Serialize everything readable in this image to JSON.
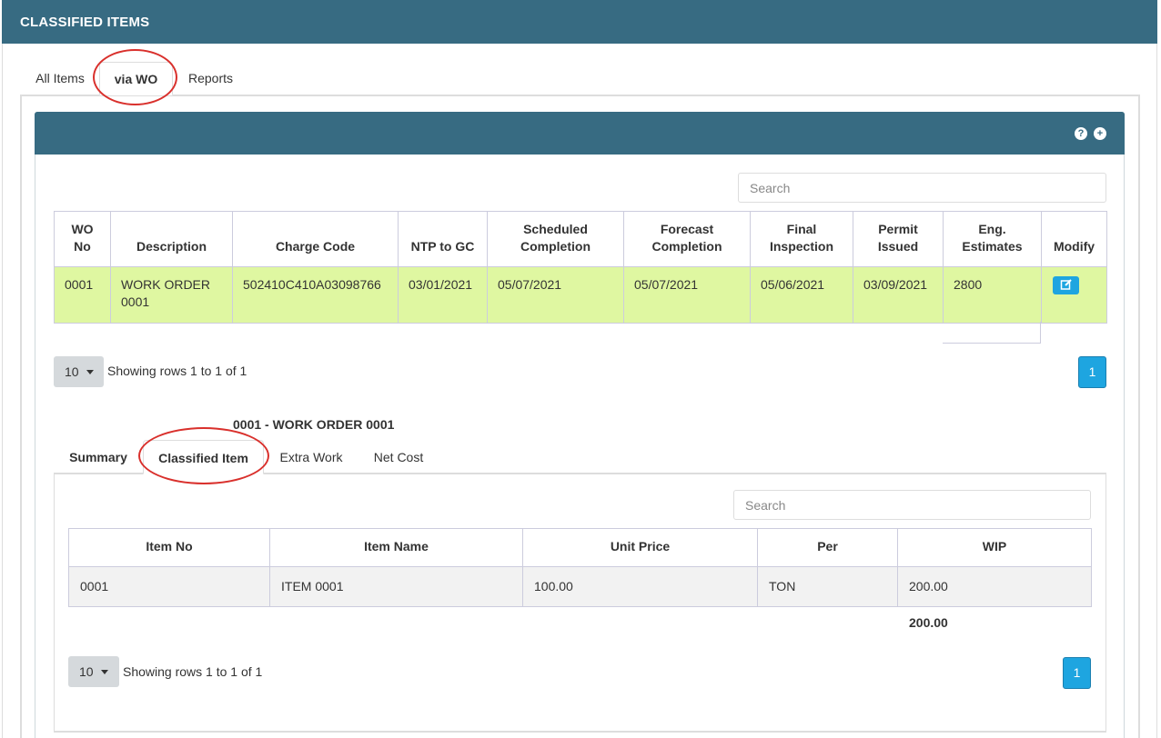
{
  "header": {
    "title": "CLASSIFIED ITEMS"
  },
  "top_tabs": [
    {
      "label": "All Items",
      "active": false
    },
    {
      "label": "via WO",
      "active": true
    },
    {
      "label": "Reports",
      "active": false
    }
  ],
  "panel": {
    "help_icon": "question-circle-icon",
    "add_icon": "plus-circle-icon"
  },
  "wo_search": {
    "placeholder": "Search"
  },
  "wo_table": {
    "headers": [
      "WO No",
      "Description",
      "Charge Code",
      "NTP to GC",
      "Scheduled Completion",
      "Forecast Completion",
      "Final Inspection",
      "Permit Issued",
      "Eng. Estimates",
      "Modify"
    ],
    "rows": [
      {
        "wo_no": "0001",
        "description": "WORK ORDER 0001",
        "charge_code": "502410C410A03098766",
        "ntp": "03/01/2021",
        "scheduled": "05/07/2021",
        "forecast": "05/07/2021",
        "final": "05/06/2021",
        "permit": "03/09/2021",
        "estimate": "2800",
        "modify_icon": "edit-icon"
      }
    ]
  },
  "wo_pager": {
    "page_size": "10",
    "showing": "Showing rows 1 to 1 of 1",
    "page": "1"
  },
  "wo_title": "0001 - WORK ORDER 0001",
  "sub_tabs": [
    {
      "label": "Summary",
      "active": false
    },
    {
      "label": "Classified Item",
      "active": true
    },
    {
      "label": "Extra Work",
      "active": false
    },
    {
      "label": "Net Cost",
      "active": false
    }
  ],
  "ci_search": {
    "placeholder": "Search"
  },
  "ci_table": {
    "headers": [
      "Item No",
      "Item Name",
      "Unit Price",
      "Per",
      "WIP"
    ],
    "rows": [
      {
        "item_no": "0001",
        "item_name": "ITEM 0001",
        "unit_price": "100.00",
        "per": "TON",
        "wip": "200.00"
      }
    ],
    "total": "200.00"
  },
  "ci_pager": {
    "page_size": "10",
    "showing": "Showing rows 1 to 1 of 1",
    "page": "1"
  },
  "colors": {
    "header": "#376b82",
    "row_highlight": "#dff7a1",
    "accent": "#1ea5e0",
    "annotation": "#d9302c"
  }
}
